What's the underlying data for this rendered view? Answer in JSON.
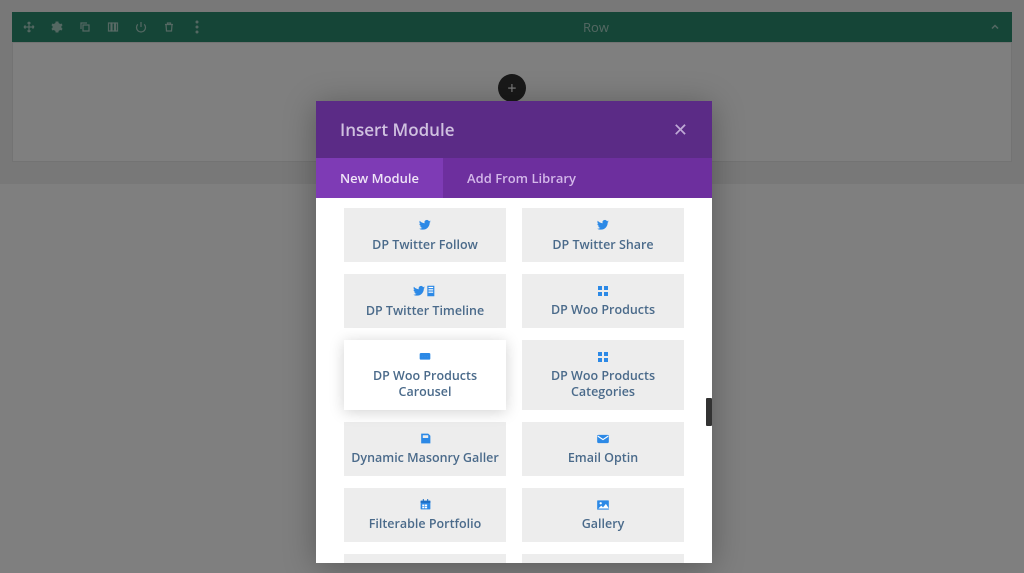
{
  "toolbar": {
    "row_label": "Row",
    "icons": {
      "move": "move-icon",
      "settings": "gear-icon",
      "clone": "duplicate-icon",
      "columns": "columns-icon",
      "power": "power-icon",
      "delete": "trash-icon",
      "more": "more-icon",
      "collapse": "chevron-up-icon"
    },
    "add_label": "+"
  },
  "modal": {
    "title": "Insert Module",
    "close": "✕",
    "tabs": {
      "new": "New Module",
      "library": "Add From Library"
    },
    "modules": [
      {
        "label": "DP Twitter Follow",
        "icon": "twitter-icon",
        "hovered": false,
        "tall": false
      },
      {
        "label": "DP Twitter Share",
        "icon": "twitter-icon",
        "hovered": false,
        "tall": false
      },
      {
        "label": "DP Twitter Timeline",
        "icon": "twitter-timeline-icon",
        "hovered": false,
        "tall": false
      },
      {
        "label": "DP Woo Products",
        "icon": "grid-icon",
        "hovered": false,
        "tall": false
      },
      {
        "label": "DP Woo Products Carousel",
        "icon": "carousel-icon",
        "hovered": true,
        "tall": true
      },
      {
        "label": "DP Woo Products Categories",
        "icon": "grid-icon",
        "hovered": false,
        "tall": true
      },
      {
        "label": "Dynamic Masonry Galler",
        "icon": "save-icon",
        "hovered": false,
        "tall": false
      },
      {
        "label": "Email Optin",
        "icon": "envelope-icon",
        "hovered": false,
        "tall": false
      },
      {
        "label": "Filterable Portfolio",
        "icon": "calendar-icon",
        "hovered": false,
        "tall": false
      },
      {
        "label": "Gallery",
        "icon": "image-icon",
        "hovered": false,
        "tall": false
      }
    ]
  },
  "colors": {
    "toolbar": "#2a8a6f",
    "modal_header": "#5b2b86",
    "modal_tabs": "#6d2f9e",
    "modal_tab_active": "#7e3bb5",
    "icon_blue": "#2c89e6"
  }
}
